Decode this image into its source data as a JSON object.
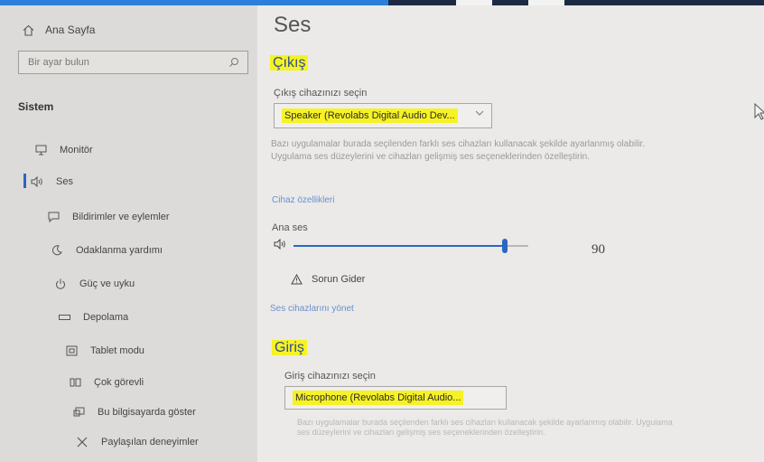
{
  "sidebar": {
    "home_label": "Ana Sayfa",
    "search_placeholder": "Bir ayar bulun",
    "section_title": "Sistem",
    "items": [
      {
        "label": "Monitör",
        "icon": "monitor-icon"
      },
      {
        "label": "Ses",
        "icon": "speaker-icon",
        "active": true
      },
      {
        "label": "Bildirimler ve eylemler",
        "icon": "notification-icon"
      },
      {
        "label": "Odaklanma yardımı",
        "icon": "moon-icon"
      },
      {
        "label": "Güç ve uyku",
        "icon": "power-icon"
      },
      {
        "label": "Depolama",
        "icon": "storage-icon"
      },
      {
        "label": "Tablet modu",
        "icon": "tablet-icon"
      },
      {
        "label": "Çok görevli",
        "icon": "multitask-icon"
      },
      {
        "label": "Bu bilgisayarda göster",
        "icon": "project-icon"
      },
      {
        "label": "Paylaşılan deneyimler",
        "icon": "shared-icon"
      }
    ]
  },
  "main": {
    "title": "Ses",
    "output": {
      "heading": "Çıkış",
      "select_label": "Çıkış cihazınızı seçin",
      "device": "Speaker (Revolabs Digital Audio Dev...",
      "description": "Bazı uygulamalar burada seçilenden farklı ses cihazları kullanacak şekilde ayarlanmış olabilir. Uygulama ses düzeylerini ve cihazları gelişmiş ses seçeneklerinden özelleştirin.",
      "device_properties_link": "Cihaz özellikleri",
      "master_volume_label": "Ana ses",
      "volume": 90,
      "volume_text": "90",
      "troubleshoot_label": "Sorun Gider",
      "manage_devices_link": "Ses cihazlarını yönet"
    },
    "input": {
      "heading": "Giriş",
      "select_label": "Giriş cihazınızı seçin",
      "device": "Microphone (Revolabs Digital Audio...",
      "description": "Bazı uygulamalar burada seçilenden farklı ses cihazları kullanacak şekilde ayarlanmış olabilir. Uygulama ses düzeylerini ve cihazları gelişmiş ses seçeneklerinden özelleştirin."
    }
  },
  "colors": {
    "accent": "#2a66c4",
    "highlight": "#f6f225",
    "sidebar_bg": "#dcdbd9",
    "main_bg": "#ebeae8"
  }
}
